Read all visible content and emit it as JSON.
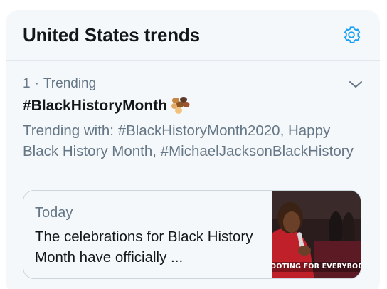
{
  "panel": {
    "title": "United States trends",
    "settings_icon": "gear-icon"
  },
  "trend": {
    "rank": "1",
    "separator": "·",
    "category": "Trending",
    "name": "#BlackHistoryMonth",
    "emoji_icon": "raised-fists-emoji-icon",
    "trending_with": "Trending with: #BlackHistoryMonth2020, Happy Black History Month, #MichaelJacksonBlackHistory"
  },
  "news": {
    "time": "Today",
    "headline": "The celebrations for Black History Month have officially ...",
    "thumbnail_caption": "OOTING FOR EVERYBODY B"
  },
  "colors": {
    "accent": "#1da1f2",
    "text_primary": "#14171a",
    "text_secondary": "#657786",
    "panel_bg": "#f5f8fa",
    "border": "#e1e8ed"
  }
}
